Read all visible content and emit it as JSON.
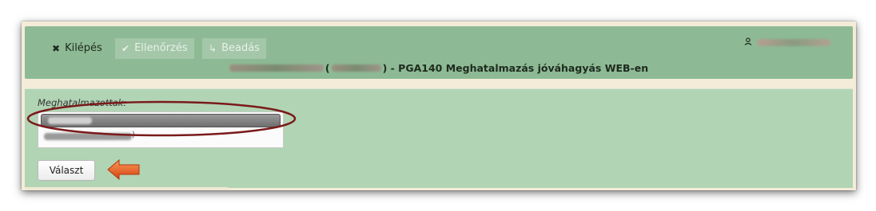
{
  "toolbar": {
    "exit_icon": "close-icon",
    "exit_label": "Kilépés",
    "check_icon": "checkmark-icon",
    "check_label": "Ellenőrzés",
    "submit_icon": "return-arrow-icon",
    "submit_label": "Beadás"
  },
  "user": {
    "icon": "user-icon"
  },
  "title": {
    "open_paren": "(",
    "text": ") - PGA140 Meghatalmazás jóváhagyás WEB-en"
  },
  "main": {
    "label": "Meghatalmazottak:",
    "list_item_suffix": ")",
    "select_button": "Választ"
  },
  "colors": {
    "header_bg": "#8dba94",
    "content_bg": "#b1d4b4",
    "frame_bg": "#f4ecd8",
    "highlight_ellipse": "#7a1a1a",
    "arrow": "#e85a1c"
  }
}
